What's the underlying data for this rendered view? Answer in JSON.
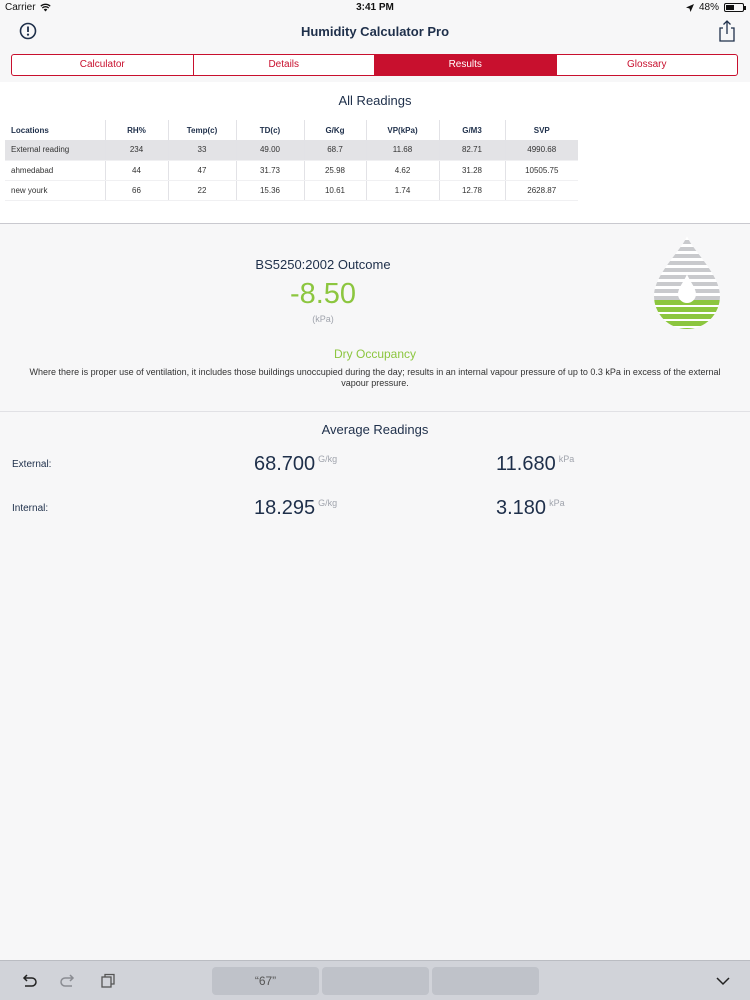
{
  "status_bar": {
    "carrier": "Carrier",
    "time": "3:41 PM",
    "battery": "48%"
  },
  "nav": {
    "title": "Humidity Calculator Pro",
    "info_icon": "info-circle-icon",
    "share_icon": "share-icon"
  },
  "tabs": [
    {
      "label": "Calculator",
      "active": false
    },
    {
      "label": "Details",
      "active": false
    },
    {
      "label": "Results",
      "active": true
    },
    {
      "label": "Glossary",
      "active": false
    }
  ],
  "all_readings": {
    "title": "All Readings",
    "columns": [
      "Locations",
      "RH%",
      "Temp(c)",
      "TD(c)",
      "G/Kg",
      "VP(kPa)",
      "G/M3",
      "SVP"
    ],
    "rows": [
      [
        "External reading",
        "234",
        "33",
        "49.00",
        "68.7",
        "11.68",
        "82.71",
        "4990.68"
      ],
      [
        "ahmedabad",
        "44",
        "47",
        "31.73",
        "25.98",
        "4.62",
        "31.28",
        "10505.75"
      ],
      [
        "new yourk",
        "66",
        "22",
        "15.36",
        "10.61",
        "1.74",
        "12.78",
        "2628.87"
      ]
    ]
  },
  "outcome": {
    "title": "BS5250:2002 Outcome",
    "value": "-8.50",
    "unit": "(kPa)",
    "occupancy_title": "Dry Occupancy",
    "occupancy_desc": "Where there is proper use of ventilation, it includes those buildings unoccupied during the day; results in an internal vapour pressure of up to 0.3 kPa in excess of the external vapour pressure.",
    "logo_icon": "water-drop-logo-icon"
  },
  "average_readings": {
    "title": "Average Readings",
    "external": {
      "label": "External:",
      "gkg": "68.700",
      "gkg_unit": "G/kg",
      "kpa": "11.680",
      "kpa_unit": "kPa"
    },
    "internal": {
      "label": "Internal:",
      "gkg": "18.295",
      "gkg_unit": "G/kg",
      "kpa": "3.180",
      "kpa_unit": "kPa"
    }
  },
  "keyboard_bar": {
    "suggestion": "“67”",
    "undo_icon": "undo-icon",
    "redo_icon": "redo-icon",
    "paste_icon": "paste-icon",
    "dismiss_icon": "chevron-down-icon"
  },
  "colors": {
    "accent": "#c8102e",
    "green": "#8cc63f",
    "navy": "#1e2f4a"
  }
}
